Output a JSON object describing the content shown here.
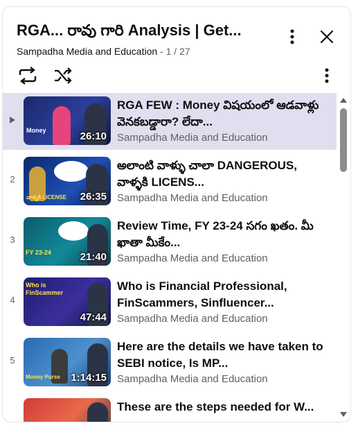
{
  "header": {
    "title": "RGA... రావు గారి Analysis  | Get...",
    "channel": "Sampadha Media and Education",
    "position": " - 1 / 27"
  },
  "icons": {
    "more": "more-vert-icon",
    "close": "close-icon",
    "loop": "loop-icon",
    "shuffle": "shuffle-icon",
    "now_playing": "play-indicator-icon"
  },
  "colors": {
    "active_row": "#e0dff0",
    "secondary_text": "#606060"
  },
  "videos": [
    {
      "index": "",
      "title": "RGA FEW : Money విషయంలో ఆడవాళ్లు వెనకబడ్డారా? లేదా...",
      "channel": "Sampadha Media and Education",
      "duration": "26:10",
      "thumb_text": "Money",
      "active": true
    },
    {
      "index": "2",
      "title": "అలాంటి వాళ్ళు చాలా DANGEROUS, వాళ్ళకి LICENS...",
      "channel": "Sampadha Media and Education",
      "duration": "26:35",
      "thumb_text": "వాళ్ళకి LICENSE",
      "active": false
    },
    {
      "index": "3",
      "title": "Review Time, FY 23-24 సగం ఖతం. మీ ఖాతా మీకేం...",
      "channel": "Sampadha Media and Education",
      "duration": "21:40",
      "thumb_text": "FY 23-24",
      "active": false
    },
    {
      "index": "4",
      "title": "Who is Financial Professional, FinScammers, Sinfluencer...",
      "channel": "Sampadha Media and Education",
      "duration": "47:44",
      "thumb_text": "Who is FinScammer",
      "active": false
    },
    {
      "index": "5",
      "title": "Here are the details we have taken to SEBI notice, Is MP...",
      "channel": "Sampadha Media and Education",
      "duration": "1:14:15",
      "thumb_text": "Money Purse",
      "active": false
    },
    {
      "index": "",
      "title": "These are the steps needed for W...",
      "channel": "",
      "duration": "",
      "thumb_text": "",
      "active": false
    }
  ]
}
